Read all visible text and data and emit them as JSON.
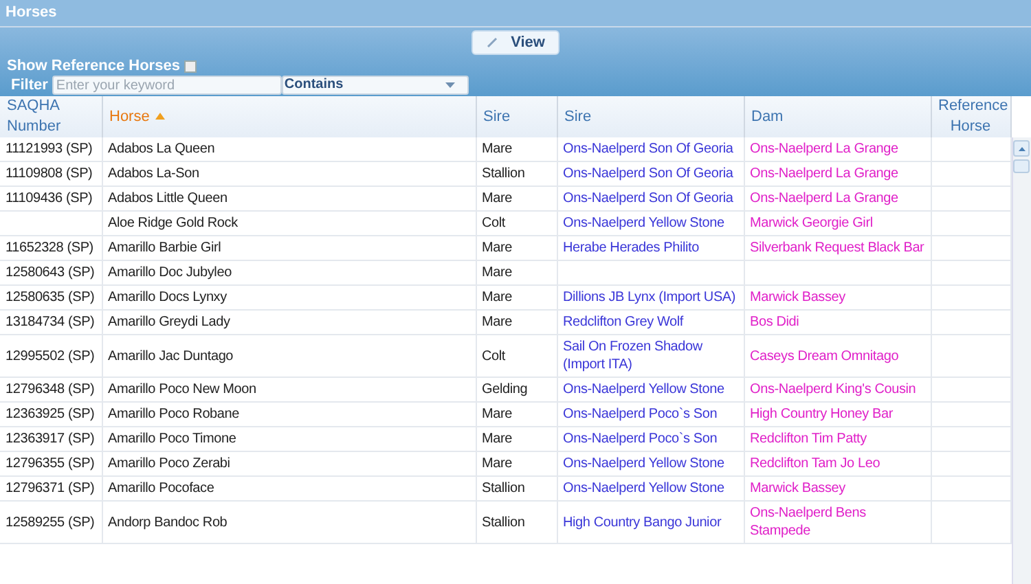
{
  "panel": {
    "title": "Horses"
  },
  "toolbar": {
    "view_button": "View",
    "show_reference": {
      "label": "Show Reference Horses",
      "checked": false
    },
    "filter": {
      "label": "Filter",
      "placeholder": "Enter your keyword",
      "match": "Contains"
    }
  },
  "table": {
    "columns": [
      {
        "label": "SAQHA Number",
        "sorted": false
      },
      {
        "label": "Horse",
        "sorted": true
      },
      {
        "label": "Sire",
        "sorted": false
      },
      {
        "label": "Sire",
        "sorted": false
      },
      {
        "label": "Dam",
        "sorted": false
      },
      {
        "label": "Reference Horse",
        "sorted": false
      }
    ],
    "rows": [
      {
        "saqha": "11121993 (SP)",
        "horse": "Adabos La Queen",
        "sex": "Mare",
        "sire": "Ons-Naelperd Son Of Georia",
        "dam": "Ons-Naelperd La Grange"
      },
      {
        "saqha": "11109808 (SP)",
        "horse": "Adabos La-Son",
        "sex": "Stallion",
        "sire": "Ons-Naelperd Son Of Georia",
        "dam": "Ons-Naelperd La Grange"
      },
      {
        "saqha": "11109436 (SP)",
        "horse": "Adabos Little Queen",
        "sex": "Mare",
        "sire": "Ons-Naelperd Son Of Georia",
        "dam": "Ons-Naelperd La Grange"
      },
      {
        "horse": "Aloe Ridge Gold Rock",
        "sex": "Colt",
        "sire": "Ons-Naelperd Yellow Stone",
        "dam": "Marwick Georgie Girl"
      },
      {
        "saqha": "11652328 (SP)",
        "horse": "Amarillo Barbie Girl",
        "sex": "Mare",
        "sire": "Herabe Herades Philito",
        "dam": "Silverbank Request Black Bar"
      },
      {
        "saqha": "12580643 (SP)",
        "horse": "Amarillo Doc Jubyleo",
        "sex": "Mare"
      },
      {
        "saqha": "12580635 (SP)",
        "horse": "Amarillo Docs Lynxy",
        "sex": "Mare",
        "sire": "Dillions JB Lynx (Import USA)",
        "dam": "Marwick Bassey"
      },
      {
        "saqha": "13184734 (SP)",
        "horse": "Amarillo Greydi Lady",
        "sex": "Mare",
        "sire": "Redclifton Grey Wolf",
        "dam": "Bos Didi"
      },
      {
        "saqha": "12995502 (SP)",
        "horse": "Amarillo Jac Duntago",
        "sex": "Colt",
        "sire": "Sail On Frozen Shadow (Import ITA)",
        "dam": "Caseys Dream Omnitago"
      },
      {
        "saqha": "12796348 (SP)",
        "horse": "Amarillo Poco New Moon",
        "sex": "Gelding",
        "sire": "Ons-Naelperd Yellow Stone",
        "dam": "Ons-Naelperd King's Cousin"
      },
      {
        "saqha": "12363925 (SP)",
        "horse": "Amarillo Poco Robane",
        "sex": "Mare",
        "sire": "Ons-Naelperd Poco`s Son",
        "dam": "High Country Honey Bar"
      },
      {
        "saqha": "12363917 (SP)",
        "horse": "Amarillo Poco Timone",
        "sex": "Mare",
        "sire": "Ons-Naelperd Poco`s Son",
        "dam": "Redclifton Tim Patty"
      },
      {
        "saqha": "12796355 (SP)",
        "horse": "Amarillo Poco Zerabi",
        "sex": "Mare",
        "sire": "Ons-Naelperd Yellow Stone",
        "dam": "Redclifton Tam Jo Leo"
      },
      {
        "saqha": "12796371 (SP)",
        "horse": "Amarillo Pocoface",
        "sex": "Stallion",
        "sire": "Ons-Naelperd Yellow Stone",
        "dam": "Marwick Bassey"
      },
      {
        "saqha": "12589255 (SP)",
        "horse": "Andorp Bandoc Rob",
        "sex": "Stallion",
        "sire": "High Country Bango Junior",
        "dam": "Ons-Naelperd Bens Stampede"
      }
    ]
  }
}
